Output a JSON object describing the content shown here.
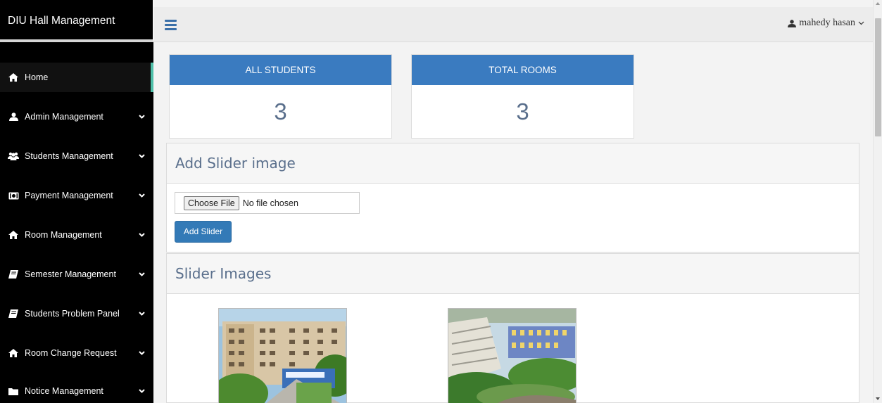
{
  "brand": "DIU Hall Management",
  "user": {
    "name": "mahedy hasan"
  },
  "sidebar": {
    "items": [
      {
        "label": "Home",
        "icon": "home-icon",
        "active": true
      },
      {
        "label": "Admin Management",
        "icon": "user-icon"
      },
      {
        "label": "Students Management",
        "icon": "users-icon"
      },
      {
        "label": "Payment Management",
        "icon": "money-icon"
      },
      {
        "label": "Room Management",
        "icon": "home-icon"
      },
      {
        "label": "Semester Management",
        "icon": "book-icon"
      },
      {
        "label": "Students Problem Panel",
        "icon": "book-icon"
      },
      {
        "label": "Room Change Request",
        "icon": "home-icon"
      },
      {
        "label": "Notice Management",
        "icon": "folder-icon"
      }
    ]
  },
  "stats": {
    "students": {
      "label": "ALL STUDENTS",
      "value": "3"
    },
    "rooms": {
      "label": "TOTAL ROOMS",
      "value": "3"
    }
  },
  "slider_form": {
    "title": "Add Slider image",
    "choose_label": "Choose File",
    "file_status": "No file chosen",
    "submit_label": "Add Slider"
  },
  "slider_images": {
    "title": "Slider Images"
  },
  "colors": {
    "accent": "#337ab7",
    "card_header": "#3a7bc0",
    "active_marker": "#4fbfa8",
    "sidebar_bg": "#000000"
  }
}
